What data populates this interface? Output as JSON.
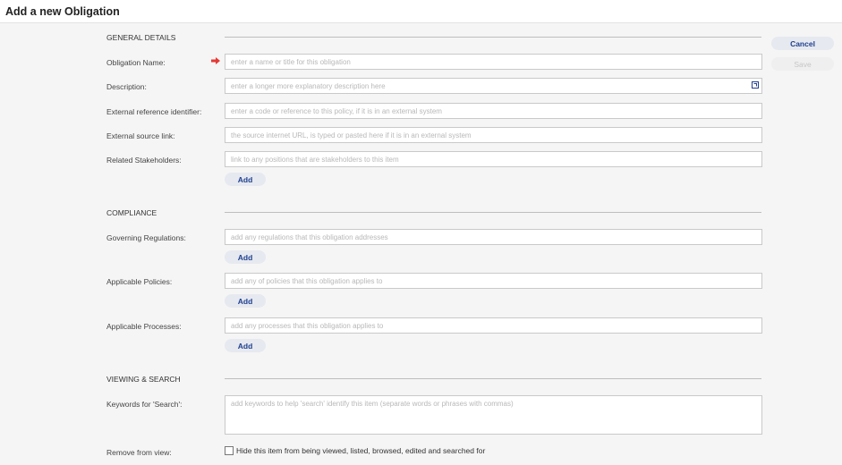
{
  "header": {
    "title": "Add a new Obligation"
  },
  "actions": {
    "cancel_label": "Cancel",
    "save_label": "Save"
  },
  "sections": {
    "general": "GENERAL DETAILS",
    "compliance": "COMPLIANCE",
    "viewing": "VIEWING & SEARCH"
  },
  "fields": {
    "obligation_name": {
      "label": "Obligation Name:",
      "value": "",
      "placeholder": "enter a name or title for this obligation"
    },
    "description": {
      "label": "Description:",
      "value": "",
      "placeholder": "enter a longer more explanatory description here"
    },
    "external_reference": {
      "label": "External reference identifier:",
      "value": "",
      "placeholder": "enter a code or reference to this policy, if it is in an external system"
    },
    "external_source": {
      "label": "External source link:",
      "value": "",
      "placeholder": "the source internet URL, is typed or pasted here if it is in an external system"
    },
    "related_stakeholders": {
      "label": "Related Stakeholders:",
      "value": "",
      "placeholder": "link to any positions that are stakeholders to this item"
    },
    "governing_regulations": {
      "label": "Governing Regulations:",
      "value": "",
      "placeholder": "add any regulations that this obligation addresses"
    },
    "applicable_policies": {
      "label": "Applicable Policies:",
      "value": "",
      "placeholder": "add any of policies that this obligation applies to"
    },
    "applicable_processes": {
      "label": "Applicable Processes:",
      "value": "",
      "placeholder": "add any processes that this obligation applies to"
    },
    "keywords": {
      "label": "Keywords for 'Search':",
      "value": "",
      "placeholder": "add keywords to help 'search' identify this item (separate words or phrases with commas)"
    },
    "remove_from_view": {
      "label": "Remove from view:",
      "checkbox_label": "Hide this item from being viewed, listed, browsed, edited and searched for",
      "checked": false
    }
  },
  "add_label": "Add",
  "icons": {
    "required": "red-arrow-icon",
    "expand": "expand-icon"
  },
  "colors": {
    "accent": "#1f3f8f",
    "required": "#e53935"
  }
}
